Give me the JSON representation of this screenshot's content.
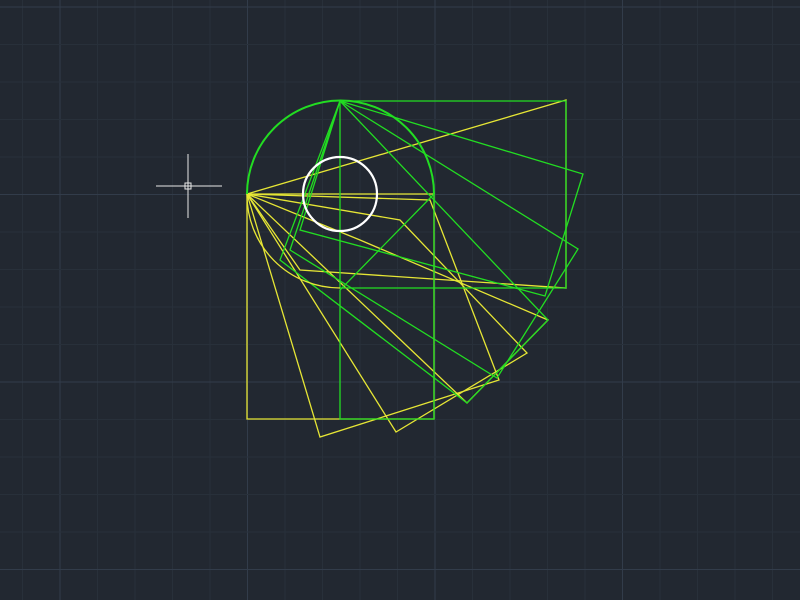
{
  "canvas": {
    "background_color": "#222831",
    "grid_minor_color": "#28303a",
    "grid_major_color": "#323c4a",
    "colors": {
      "yellow": "#e6e635",
      "green": "#22dd22",
      "white": "#ffffff",
      "crosshair": "#e8e8e8"
    }
  },
  "drawing": {
    "entities": [
      "rectangle",
      "rectangle",
      "rectangle",
      "rectangle",
      "rectangle",
      "rectangle",
      "rectangle",
      "rectangle",
      "rectangle",
      "rectangle",
      "arc",
      "circle"
    ]
  },
  "cursor": {
    "icon": "crosshair-icon",
    "pickbox_icon": "pickbox-icon"
  }
}
